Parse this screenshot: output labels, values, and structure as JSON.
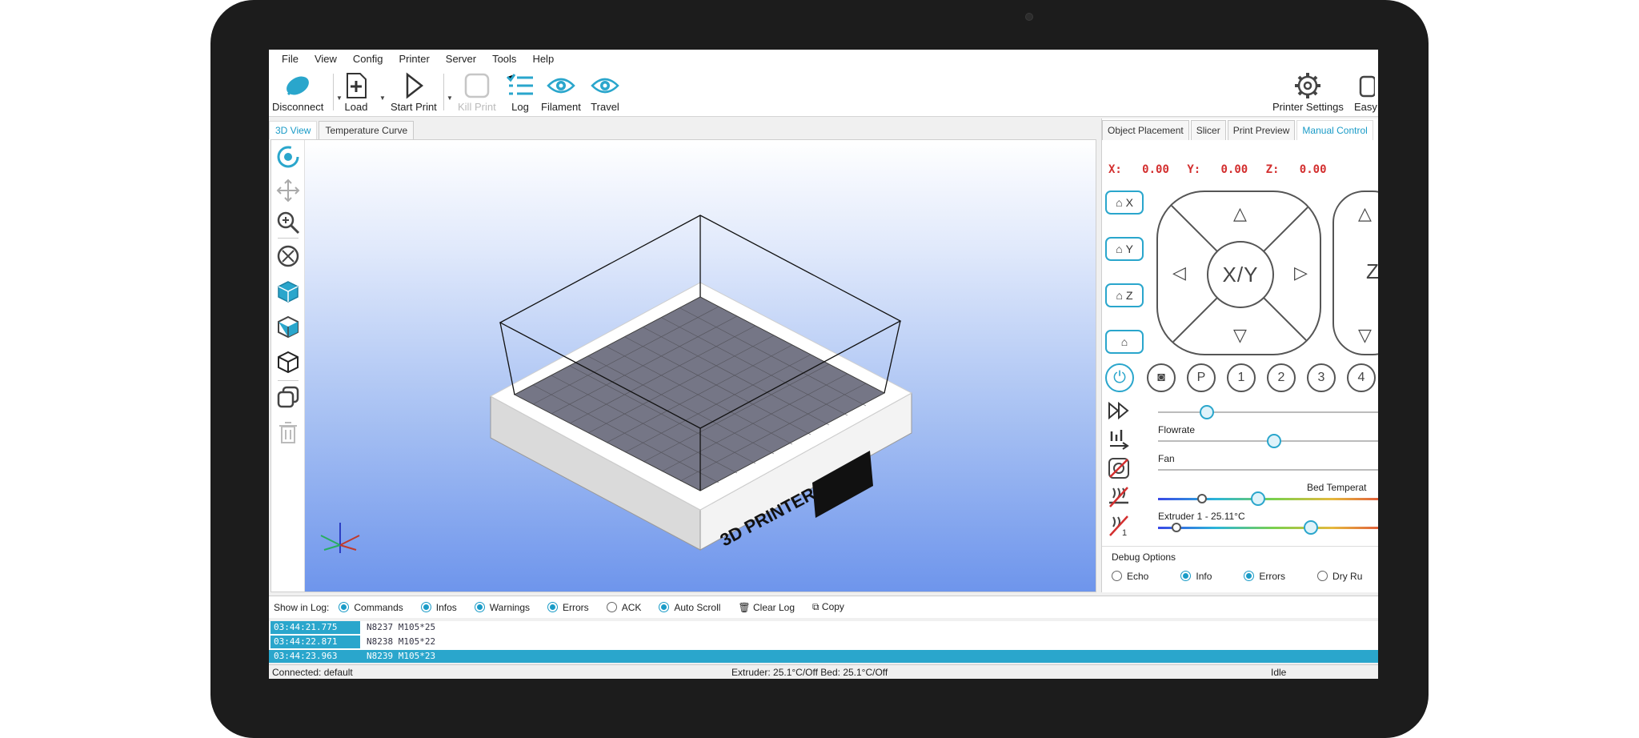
{
  "menu": [
    "File",
    "View",
    "Config",
    "Printer",
    "Server",
    "Tools",
    "Help"
  ],
  "toolbar": {
    "disconnect": "Disconnect",
    "load": "Load",
    "start_print": "Start Print",
    "kill_print": "Kill Print",
    "log": "Log",
    "filament": "Filament",
    "travel": "Travel",
    "printer_settings": "Printer Settings",
    "easy_mode": "Easy"
  },
  "left_tabs": [
    "3D View",
    "Temperature Curve"
  ],
  "bed_label": "3D PRINTER",
  "right_tabs": [
    "Object Placement",
    "Slicer",
    "Print Preview",
    "Manual Control"
  ],
  "coords": {
    "x_label": "X:",
    "x": "0.00",
    "y_label": "Y:",
    "y": "0.00",
    "z_label": "Z:",
    "z": "0.00"
  },
  "home": {
    "x": "X",
    "y": "Y",
    "z": "Z"
  },
  "pad": {
    "xy": "X/Y",
    "z": "Z"
  },
  "buttons": {
    "p": "P",
    "b1": "1",
    "b2": "2",
    "b3": "3",
    "b4": "4"
  },
  "sliders": {
    "speed": {
      "value": 0.21
    },
    "flowrate": {
      "label": "Flowrate",
      "value": 0.5
    },
    "fan": {
      "label": "Fan"
    },
    "bed": {
      "label": "Bed Temperat",
      "value": 0.43
    },
    "extruder": {
      "label": "Extruder 1 - 25.11°C",
      "value": 0.66,
      "extruder_num": "1"
    }
  },
  "debug": {
    "title": "Debug Options",
    "echo": "Echo",
    "info": "Info",
    "errors": "Errors",
    "dry_run": "Dry Ru"
  },
  "log_filters": {
    "show_in_log": "Show in Log:",
    "commands": "Commands",
    "infos": "Infos",
    "warnings": "Warnings",
    "errors": "Errors",
    "ack": "ACK",
    "auto_scroll": "Auto Scroll",
    "clear_log": "Clear Log",
    "copy": "Copy"
  },
  "log_rows": [
    {
      "time": "03:44:21.775",
      "msg": "N8237 M105*25"
    },
    {
      "time": "03:44:22.871",
      "msg": "N8238 M105*22"
    },
    {
      "time": "03:44:23.963",
      "msg": "N8239 M105*23"
    }
  ],
  "status": {
    "connection": "Connected: default",
    "temps": "Extruder: 25.1°C/Off Bed: 25.1°C/Off",
    "state": "Idle"
  },
  "colors": {
    "accent": "#2aa6cc",
    "coords": "#d32f2f",
    "bezel": "#1c1c1c"
  }
}
